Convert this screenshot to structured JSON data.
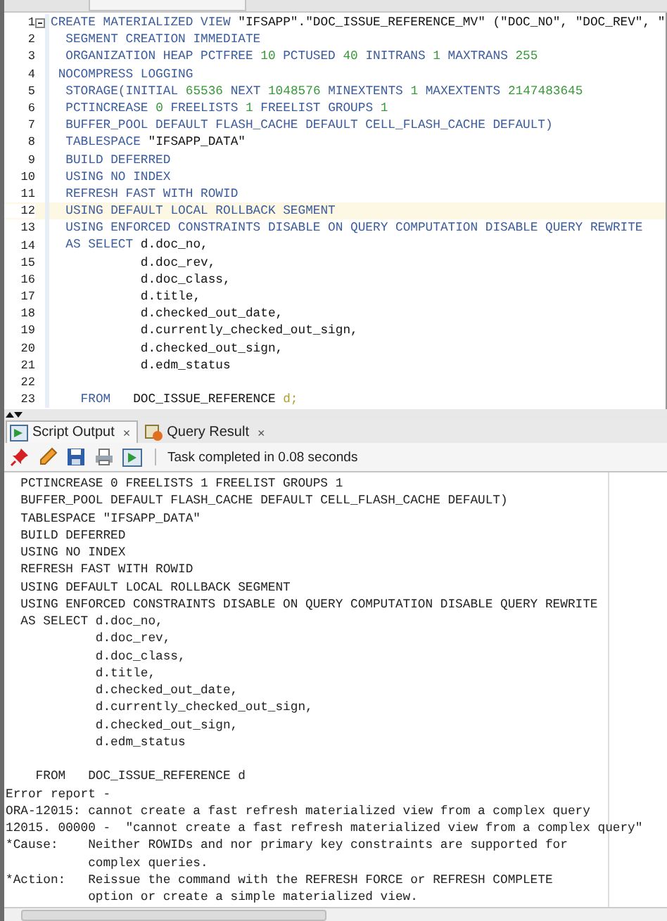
{
  "editor": {
    "lines": [
      {
        "number": "1",
        "foldable": true,
        "current": false,
        "segments": [
          {
            "kind": "keyword",
            "text": "CREATE MATERIALIZED VIEW "
          },
          {
            "kind": "plain",
            "text": "\"IFSAPP\".\"DOC_ISSUE_REFERENCE_MV\" (\"DOC_NO\", \"DOC_REV\", \""
          }
        ]
      },
      {
        "number": "2",
        "foldable": false,
        "current": false,
        "segments": [
          {
            "kind": "keyword",
            "text": "  SEGMENT CREATION IMMEDIATE"
          }
        ]
      },
      {
        "number": "3",
        "foldable": false,
        "current": false,
        "segments": [
          {
            "kind": "keyword",
            "text": "  ORGANIZATION HEAP PCTFREE "
          },
          {
            "kind": "number",
            "text": "10"
          },
          {
            "kind": "keyword",
            "text": " PCTUSED "
          },
          {
            "kind": "number",
            "text": "40"
          },
          {
            "kind": "keyword",
            "text": " INITRANS "
          },
          {
            "kind": "number",
            "text": "1"
          },
          {
            "kind": "keyword",
            "text": " MAXTRANS "
          },
          {
            "kind": "number",
            "text": "255"
          }
        ]
      },
      {
        "number": "4",
        "foldable": false,
        "current": false,
        "segments": [
          {
            "kind": "keyword",
            "text": " NOCOMPRESS LOGGING"
          }
        ]
      },
      {
        "number": "5",
        "foldable": false,
        "current": false,
        "segments": [
          {
            "kind": "keyword",
            "text": "  STORAGE(INITIAL "
          },
          {
            "kind": "number",
            "text": "65536"
          },
          {
            "kind": "keyword",
            "text": " NEXT "
          },
          {
            "kind": "number",
            "text": "1048576"
          },
          {
            "kind": "keyword",
            "text": " MINEXTENTS "
          },
          {
            "kind": "number",
            "text": "1"
          },
          {
            "kind": "keyword",
            "text": " MAXEXTENTS "
          },
          {
            "kind": "number",
            "text": "2147483645"
          }
        ]
      },
      {
        "number": "6",
        "foldable": false,
        "current": false,
        "segments": [
          {
            "kind": "keyword",
            "text": "  PCTINCREASE "
          },
          {
            "kind": "number",
            "text": "0"
          },
          {
            "kind": "keyword",
            "text": " FREELISTS "
          },
          {
            "kind": "number",
            "text": "1"
          },
          {
            "kind": "keyword",
            "text": " FREELIST GROUPS "
          },
          {
            "kind": "number",
            "text": "1"
          }
        ]
      },
      {
        "number": "7",
        "foldable": false,
        "current": false,
        "segments": [
          {
            "kind": "keyword",
            "text": "  BUFFER_POOL DEFAULT FLASH_CACHE DEFAULT CELL_FLASH_CACHE DEFAULT)"
          }
        ]
      },
      {
        "number": "8",
        "foldable": false,
        "current": false,
        "segments": [
          {
            "kind": "keyword",
            "text": "  TABLESPACE "
          },
          {
            "kind": "plain",
            "text": "\"IFSAPP_DATA\""
          }
        ]
      },
      {
        "number": "9",
        "foldable": false,
        "current": false,
        "segments": [
          {
            "kind": "keyword",
            "text": "  BUILD DEFERRED"
          }
        ]
      },
      {
        "number": "10",
        "foldable": false,
        "current": false,
        "segments": [
          {
            "kind": "keyword",
            "text": "  USING NO INDEX"
          }
        ]
      },
      {
        "number": "11",
        "foldable": false,
        "current": false,
        "segments": [
          {
            "kind": "keyword",
            "text": "  REFRESH FAST WITH ROWID"
          }
        ]
      },
      {
        "number": "12",
        "foldable": false,
        "current": true,
        "segments": [
          {
            "kind": "keyword",
            "text": "  USING DEFAULT LOCAL ROLLBACK SEGMENT"
          }
        ]
      },
      {
        "number": "13",
        "foldable": false,
        "current": false,
        "segments": [
          {
            "kind": "keyword",
            "text": "  USING ENFORCED CONSTRAINTS DISABLE ON QUERY COMPUTATION DISABLE QUERY REWRITE"
          }
        ]
      },
      {
        "number": "14",
        "foldable": false,
        "current": false,
        "segments": [
          {
            "kind": "keyword",
            "text": "  AS SELECT "
          },
          {
            "kind": "plain",
            "text": "d.doc_no,"
          }
        ]
      },
      {
        "number": "15",
        "foldable": false,
        "current": false,
        "segments": [
          {
            "kind": "plain",
            "text": "            d.doc_rev,"
          }
        ]
      },
      {
        "number": "16",
        "foldable": false,
        "current": false,
        "segments": [
          {
            "kind": "plain",
            "text": "            d.doc_class,"
          }
        ]
      },
      {
        "number": "17",
        "foldable": false,
        "current": false,
        "segments": [
          {
            "kind": "plain",
            "text": "            d.title,"
          }
        ]
      },
      {
        "number": "18",
        "foldable": false,
        "current": false,
        "segments": [
          {
            "kind": "plain",
            "text": "            d.checked_out_date,"
          }
        ]
      },
      {
        "number": "19",
        "foldable": false,
        "current": false,
        "segments": [
          {
            "kind": "plain",
            "text": "            d.currently_checked_out_sign,"
          }
        ]
      },
      {
        "number": "20",
        "foldable": false,
        "current": false,
        "segments": [
          {
            "kind": "plain",
            "text": "            d.checked_out_sign,"
          }
        ]
      },
      {
        "number": "21",
        "foldable": false,
        "current": false,
        "segments": [
          {
            "kind": "plain",
            "text": "            d.edm_status"
          }
        ]
      },
      {
        "number": "22",
        "foldable": false,
        "current": false
      },
      {
        "number": "23",
        "foldable": false,
        "current": false,
        "segments": [
          {
            "kind": "keyword",
            "text": "    FROM"
          },
          {
            "kind": "plain",
            "text": "   DOC_ISSUE_REFERENCE "
          },
          {
            "kind": "alias",
            "text": "d;"
          }
        ]
      }
    ]
  },
  "tabs": [
    {
      "label": "Script Output",
      "close": "×",
      "selected": true,
      "kind": "script"
    },
    {
      "label": "Query Result",
      "close": "×",
      "selected": false,
      "kind": "grid"
    }
  ],
  "toolbar": {
    "status": "Task completed in 0.08 seconds"
  },
  "output": {
    "lines": [
      {
        "text": "  PCTINCREASE 0 FREELISTS 1 FREELIST GROUPS 1",
        "blank_before": false
      },
      {
        "text": "  BUFFER_POOL DEFAULT FLASH_CACHE DEFAULT CELL_FLASH_CACHE DEFAULT)",
        "blank_before": false
      },
      {
        "text": "  TABLESPACE \"IFSAPP_DATA\"",
        "blank_before": false
      },
      {
        "text": "  BUILD DEFERRED",
        "blank_before": false
      },
      {
        "text": "  USING NO INDEX",
        "blank_before": false
      },
      {
        "text": "  REFRESH FAST WITH ROWID",
        "blank_before": false
      },
      {
        "text": "  USING DEFAULT LOCAL ROLLBACK SEGMENT",
        "blank_before": false
      },
      {
        "text": "  USING ENFORCED CONSTRAINTS DISABLE ON QUERY COMPUTATION DISABLE QUERY REWRITE",
        "blank_before": false
      },
      {
        "text": "  AS SELECT d.doc_no,",
        "blank_before": false
      },
      {
        "text": "            d.doc_rev,",
        "blank_before": false
      },
      {
        "text": "            d.doc_class,",
        "blank_before": false
      },
      {
        "text": "            d.title,",
        "blank_before": false
      },
      {
        "text": "            d.checked_out_date,",
        "blank_before": false
      },
      {
        "text": "            d.currently_checked_out_sign,",
        "blank_before": false
      },
      {
        "text": "            d.checked_out_sign,",
        "blank_before": false
      },
      {
        "text": "            d.edm_status",
        "blank_before": false
      },
      {
        "text": "    FROM   DOC_ISSUE_REFERENCE d",
        "blank_before": true
      },
      {
        "text": "Error report -",
        "blank_before": false
      },
      {
        "text": "ORA-12015: cannot create a fast refresh materialized view from a complex query",
        "blank_before": false
      },
      {
        "text": "12015. 00000 -  \"cannot create a fast refresh materialized view from a complex query\"",
        "blank_before": false
      },
      {
        "text": "*Cause:    Neither ROWIDs and nor primary key constraints are supported for",
        "blank_before": false
      },
      {
        "text": "           complex queries.",
        "blank_before": false
      },
      {
        "text": "*Action:   Reissue the command with the REFRESH FORCE or REFRESH COMPLETE",
        "blank_before": false
      },
      {
        "text": "           option or create a simple materialized view.",
        "blank_before": false
      }
    ]
  }
}
